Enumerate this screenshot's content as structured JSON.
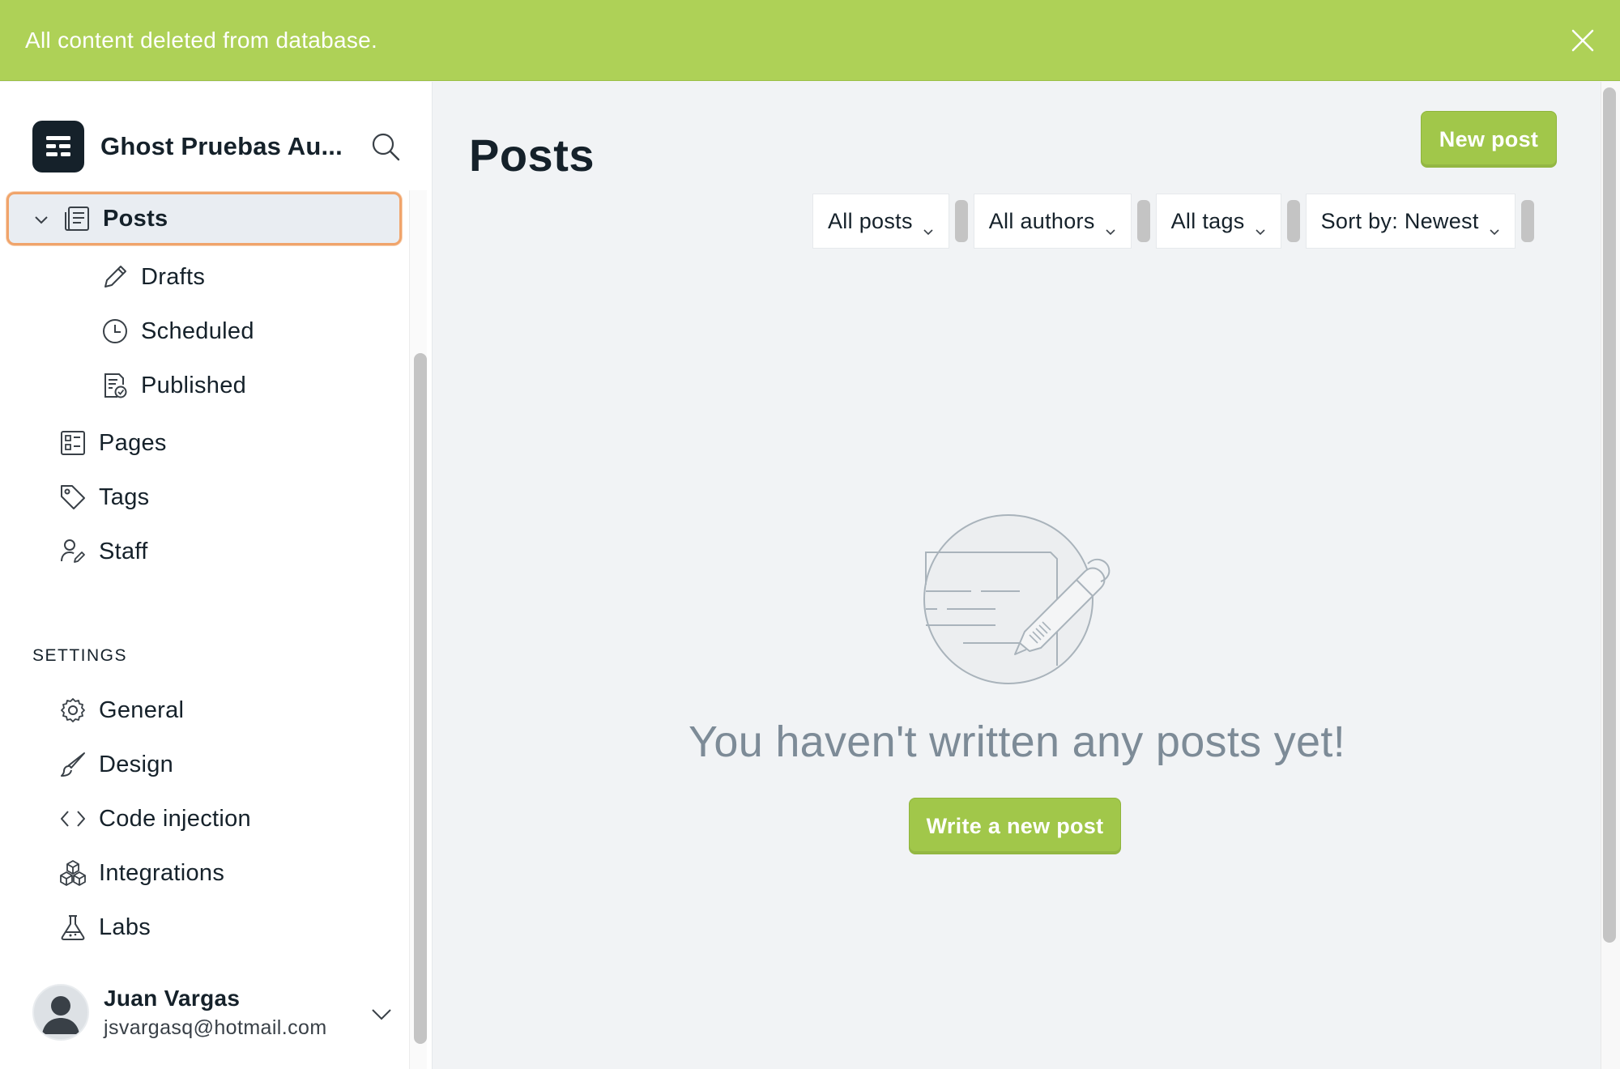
{
  "notification": {
    "message": "All content deleted from database."
  },
  "sidebar": {
    "site_name": "Ghost Pruebas Au...",
    "nav": {
      "posts": "Posts",
      "drafts": "Drafts",
      "scheduled": "Scheduled",
      "published": "Published",
      "pages": "Pages",
      "tags": "Tags",
      "staff": "Staff"
    },
    "settings_heading": "SETTINGS",
    "settings": {
      "general": "General",
      "design": "Design",
      "code_injection": "Code injection",
      "integrations": "Integrations",
      "labs": "Labs"
    },
    "user": {
      "name": "Juan Vargas",
      "email": "jsvargasq@hotmail.com"
    }
  },
  "main": {
    "title": "Posts",
    "new_post_label": "New post",
    "filters": {
      "type": "All posts",
      "author": "All authors",
      "tag": "All tags",
      "sort": "Sort by: Newest"
    },
    "empty_message": "You haven't written any posts yet!",
    "write_button_label": "Write a new post"
  },
  "colors": {
    "accent_green": "#a1c74a",
    "banner_green": "#aed157",
    "active_outline": "#f0a46b"
  }
}
